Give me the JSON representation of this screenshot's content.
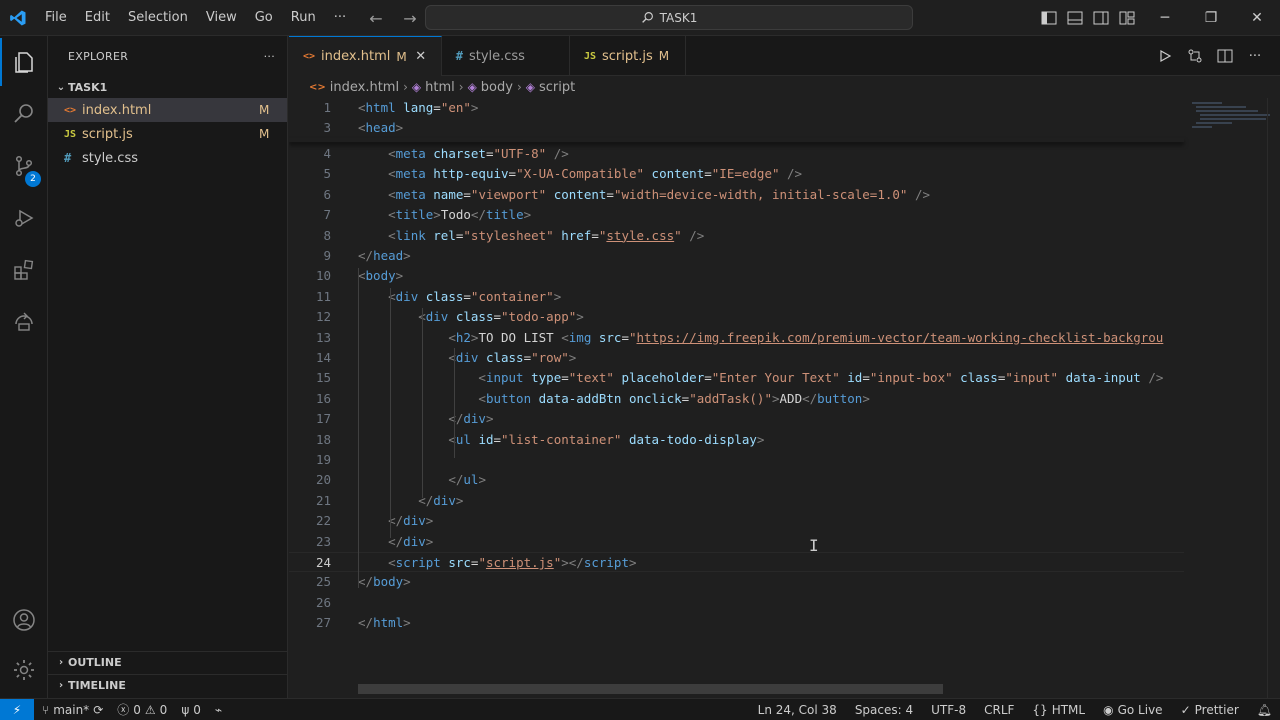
{
  "menu": [
    "File",
    "Edit",
    "Selection",
    "View",
    "Go",
    "Run",
    "···"
  ],
  "search": {
    "text": "TASK1"
  },
  "explorer": {
    "title": "EXPLORER",
    "more": "···",
    "folder": "TASK1",
    "files": [
      {
        "name": "index.html",
        "icon": "<>",
        "badge": "M",
        "selected": true,
        "modified": true
      },
      {
        "name": "script.js",
        "icon": "JS",
        "badge": "M",
        "selected": false,
        "modified": true
      },
      {
        "name": "style.css",
        "icon": "#",
        "badge": "",
        "selected": false,
        "modified": false
      }
    ],
    "outline": "OUTLINE",
    "timeline": "TIMELINE"
  },
  "activity": {
    "scm_badge": "2"
  },
  "tabs": [
    {
      "icon": "<>",
      "label": "index.html",
      "mod": "M",
      "active": true,
      "close": "✕"
    },
    {
      "icon": "#",
      "label": "style.css",
      "mod": "",
      "active": false
    },
    {
      "icon": "JS",
      "label": "script.js",
      "mod": "M",
      "active": false
    }
  ],
  "breadcrumb": [
    "index.html",
    "html",
    "body",
    "script"
  ],
  "editor": {
    "current_line": 24,
    "lines": [
      {
        "n": 1,
        "tokens": [
          [
            "br",
            "<"
          ],
          [
            "tag",
            "html"
          ],
          [
            "txt",
            " "
          ],
          [
            "attr",
            "lang"
          ],
          [
            "txt",
            "="
          ],
          [
            "str",
            "\"en\""
          ],
          [
            "br",
            ">"
          ]
        ]
      },
      {
        "n": 3,
        "tokens": [
          [
            "br",
            "<"
          ],
          [
            "tag",
            "head"
          ],
          [
            "br",
            ">"
          ]
        ]
      },
      {
        "n": 4,
        "tokens": [
          [
            "txt",
            "    "
          ],
          [
            "br",
            "<"
          ],
          [
            "tag",
            "meta"
          ],
          [
            "txt",
            " "
          ],
          [
            "attr",
            "charset"
          ],
          [
            "txt",
            "="
          ],
          [
            "str",
            "\"UTF-8\""
          ],
          [
            "txt",
            " "
          ],
          [
            "br",
            "/>"
          ]
        ]
      },
      {
        "n": 5,
        "tokens": [
          [
            "txt",
            "    "
          ],
          [
            "br",
            "<"
          ],
          [
            "tag",
            "meta"
          ],
          [
            "txt",
            " "
          ],
          [
            "attr",
            "http-equiv"
          ],
          [
            "txt",
            "="
          ],
          [
            "str",
            "\"X-UA-Compatible\""
          ],
          [
            "txt",
            " "
          ],
          [
            "attr",
            "content"
          ],
          [
            "txt",
            "="
          ],
          [
            "str",
            "\"IE=edge\""
          ],
          [
            "txt",
            " "
          ],
          [
            "br",
            "/>"
          ]
        ]
      },
      {
        "n": 6,
        "tokens": [
          [
            "txt",
            "    "
          ],
          [
            "br",
            "<"
          ],
          [
            "tag",
            "meta"
          ],
          [
            "txt",
            " "
          ],
          [
            "attr",
            "name"
          ],
          [
            "txt",
            "="
          ],
          [
            "str",
            "\"viewport\""
          ],
          [
            "txt",
            " "
          ],
          [
            "attr",
            "content"
          ],
          [
            "txt",
            "="
          ],
          [
            "str",
            "\"width=device-width, initial-scale=1.0\""
          ],
          [
            "txt",
            " "
          ],
          [
            "br",
            "/>"
          ]
        ]
      },
      {
        "n": 7,
        "tokens": [
          [
            "txt",
            "    "
          ],
          [
            "br",
            "<"
          ],
          [
            "tag",
            "title"
          ],
          [
            "br",
            ">"
          ],
          [
            "txt",
            "Todo"
          ],
          [
            "br",
            "</"
          ],
          [
            "tag",
            "title"
          ],
          [
            "br",
            ">"
          ]
        ]
      },
      {
        "n": 8,
        "tokens": [
          [
            "txt",
            "    "
          ],
          [
            "br",
            "<"
          ],
          [
            "tag",
            "link"
          ],
          [
            "txt",
            " "
          ],
          [
            "attr",
            "rel"
          ],
          [
            "txt",
            "="
          ],
          [
            "str",
            "\"stylesheet\""
          ],
          [
            "txt",
            " "
          ],
          [
            "attr",
            "href"
          ],
          [
            "txt",
            "="
          ],
          [
            "str",
            "\""
          ],
          [
            "link",
            "style.css"
          ],
          [
            "str",
            "\""
          ],
          [
            "txt",
            " "
          ],
          [
            "br",
            "/>"
          ]
        ]
      },
      {
        "n": 9,
        "tokens": [
          [
            "br",
            "</"
          ],
          [
            "tag",
            "head"
          ],
          [
            "br",
            ">"
          ]
        ]
      },
      {
        "n": 10,
        "tokens": [
          [
            "br",
            "<"
          ],
          [
            "tag",
            "body"
          ],
          [
            "br",
            ">"
          ]
        ]
      },
      {
        "n": 11,
        "tokens": [
          [
            "txt",
            "    "
          ],
          [
            "br",
            "<"
          ],
          [
            "tag",
            "div"
          ],
          [
            "txt",
            " "
          ],
          [
            "attr",
            "class"
          ],
          [
            "txt",
            "="
          ],
          [
            "str",
            "\"container\""
          ],
          [
            "br",
            ">"
          ]
        ]
      },
      {
        "n": 12,
        "tokens": [
          [
            "txt",
            "        "
          ],
          [
            "br",
            "<"
          ],
          [
            "tag",
            "div"
          ],
          [
            "txt",
            " "
          ],
          [
            "attr",
            "class"
          ],
          [
            "txt",
            "="
          ],
          [
            "str",
            "\"todo-app\""
          ],
          [
            "br",
            ">"
          ]
        ]
      },
      {
        "n": 13,
        "tokens": [
          [
            "txt",
            "            "
          ],
          [
            "br",
            "<"
          ],
          [
            "tag",
            "h2"
          ],
          [
            "br",
            ">"
          ],
          [
            "txt",
            "TO DO LIST "
          ],
          [
            "br",
            "<"
          ],
          [
            "tag",
            "img"
          ],
          [
            "txt",
            " "
          ],
          [
            "attr",
            "src"
          ],
          [
            "txt",
            "="
          ],
          [
            "str",
            "\""
          ],
          [
            "link",
            "https://img.freepik.com/premium-vector/team-working-checklist-backgrou"
          ]
        ]
      },
      {
        "n": 14,
        "tokens": [
          [
            "txt",
            "            "
          ],
          [
            "br",
            "<"
          ],
          [
            "tag",
            "div"
          ],
          [
            "txt",
            " "
          ],
          [
            "attr",
            "class"
          ],
          [
            "txt",
            "="
          ],
          [
            "str",
            "\"row\""
          ],
          [
            "br",
            ">"
          ]
        ]
      },
      {
        "n": 15,
        "tokens": [
          [
            "txt",
            "                "
          ],
          [
            "br",
            "<"
          ],
          [
            "tag",
            "input"
          ],
          [
            "txt",
            " "
          ],
          [
            "attr",
            "type"
          ],
          [
            "txt",
            "="
          ],
          [
            "str",
            "\"text\""
          ],
          [
            "txt",
            " "
          ],
          [
            "attr",
            "placeholder"
          ],
          [
            "txt",
            "="
          ],
          [
            "str",
            "\"Enter Your Text\""
          ],
          [
            "txt",
            " "
          ],
          [
            "attr",
            "id"
          ],
          [
            "txt",
            "="
          ],
          [
            "str",
            "\"input-box\""
          ],
          [
            "txt",
            " "
          ],
          [
            "attr",
            "class"
          ],
          [
            "txt",
            "="
          ],
          [
            "str",
            "\"input\""
          ],
          [
            "txt",
            " "
          ],
          [
            "attr",
            "data-input"
          ],
          [
            "txt",
            " "
          ],
          [
            "br",
            "/>"
          ]
        ]
      },
      {
        "n": 16,
        "tokens": [
          [
            "txt",
            "                "
          ],
          [
            "br",
            "<"
          ],
          [
            "tag",
            "button"
          ],
          [
            "txt",
            " "
          ],
          [
            "attr",
            "data-addBtn"
          ],
          [
            "txt",
            " "
          ],
          [
            "attr",
            "onclick"
          ],
          [
            "txt",
            "="
          ],
          [
            "str",
            "\"addTask()\""
          ],
          [
            "br",
            ">"
          ],
          [
            "txt",
            "ADD"
          ],
          [
            "br",
            "</"
          ],
          [
            "tag",
            "button"
          ],
          [
            "br",
            ">"
          ]
        ]
      },
      {
        "n": 17,
        "tokens": [
          [
            "txt",
            "            "
          ],
          [
            "br",
            "</"
          ],
          [
            "tag",
            "div"
          ],
          [
            "br",
            ">"
          ]
        ]
      },
      {
        "n": 18,
        "tokens": [
          [
            "txt",
            "            "
          ],
          [
            "br",
            "<"
          ],
          [
            "tag",
            "ul"
          ],
          [
            "txt",
            " "
          ],
          [
            "attr",
            "id"
          ],
          [
            "txt",
            "="
          ],
          [
            "str",
            "\"list-container\""
          ],
          [
            "txt",
            " "
          ],
          [
            "attr",
            "data-todo-display"
          ],
          [
            "br",
            ">"
          ]
        ]
      },
      {
        "n": 19,
        "tokens": []
      },
      {
        "n": 20,
        "tokens": [
          [
            "txt",
            "            "
          ],
          [
            "br",
            "</"
          ],
          [
            "tag",
            "ul"
          ],
          [
            "br",
            ">"
          ]
        ]
      },
      {
        "n": 21,
        "tokens": [
          [
            "txt",
            "        "
          ],
          [
            "br",
            "</"
          ],
          [
            "tag",
            "div"
          ],
          [
            "br",
            ">"
          ]
        ]
      },
      {
        "n": 22,
        "tokens": [
          [
            "txt",
            "    "
          ],
          [
            "br",
            "</"
          ],
          [
            "tag",
            "div"
          ],
          [
            "br",
            ">"
          ]
        ]
      },
      {
        "n": 23,
        "tokens": [
          [
            "txt",
            "    "
          ],
          [
            "br",
            "</"
          ],
          [
            "tag",
            "div"
          ],
          [
            "br",
            ">"
          ]
        ]
      },
      {
        "n": 24,
        "tokens": [
          [
            "txt",
            "    "
          ],
          [
            "br",
            "<"
          ],
          [
            "tag",
            "script"
          ],
          [
            "txt",
            " "
          ],
          [
            "attr",
            "src"
          ],
          [
            "txt",
            "="
          ],
          [
            "str",
            "\""
          ],
          [
            "link",
            "script.js"
          ],
          [
            "str",
            "\""
          ],
          [
            "br",
            ">"
          ],
          [
            "br",
            "</"
          ],
          [
            "tag",
            "script"
          ],
          [
            "br",
            ">"
          ]
        ]
      },
      {
        "n": 25,
        "tokens": [
          [
            "br",
            "</"
          ],
          [
            "tag",
            "body"
          ],
          [
            "br",
            ">"
          ]
        ]
      },
      {
        "n": 26,
        "tokens": []
      },
      {
        "n": 27,
        "tokens": [
          [
            "br",
            "</"
          ],
          [
            "tag",
            "html"
          ],
          [
            "br",
            ">"
          ]
        ]
      }
    ]
  },
  "status": {
    "branch": "main*",
    "errors": "0",
    "warnings": "0",
    "ports": "0",
    "position": "Ln 24, Col 38",
    "spaces": "Spaces: 4",
    "encoding": "UTF-8",
    "eol": "CRLF",
    "language": "HTML",
    "golive": "Go Live",
    "prettier": "Prettier"
  },
  "colors": {
    "accent": "#0078d4",
    "tag": "#569cd6",
    "attr": "#9cdcfe",
    "string": "#ce9178",
    "modified": "#e2c08d"
  }
}
